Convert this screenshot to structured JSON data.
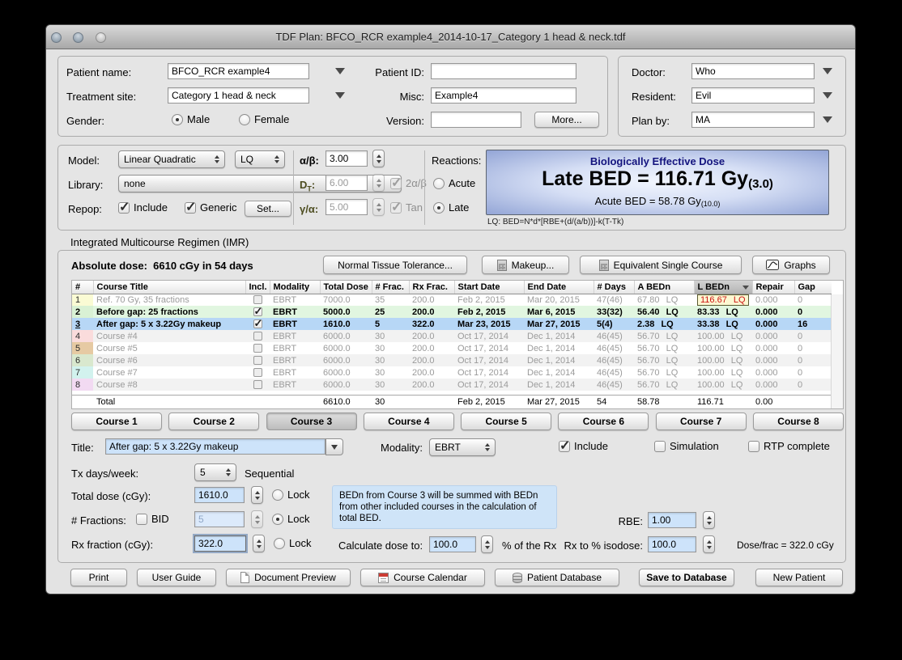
{
  "window": {
    "title": "TDF Plan: BFCO_RCR example4_2014-10-17_Category 1 head & neck.tdf"
  },
  "colors": {
    "selection_blue": "#b7d7f6",
    "field_blue": "#cde3fa",
    "alert_red": "#cc1414",
    "alert_bg": "#fdf8d2"
  },
  "patient": {
    "name_label": "Patient name:",
    "name": "BFCO_RCR example4",
    "site_label": "Treatment site:",
    "site": "Category 1 head & neck",
    "gender_label": "Gender:",
    "male": "Male",
    "female": "Female",
    "id_label": "Patient ID:",
    "id": "",
    "misc_label": "Misc:",
    "misc": "Example4",
    "version_label": "Version:",
    "version": "",
    "more": "More...",
    "doctor_label": "Doctor:",
    "doctor": "Who",
    "resident_label": "Resident:",
    "resident": "Evil",
    "planby_label": "Plan by:",
    "planby": "MA"
  },
  "model": {
    "model_label": "Model:",
    "model_value": "Linear Quadratic",
    "model_short": "LQ",
    "library_label": "Library:",
    "library_value": "none",
    "repop_label": "Repop:",
    "include": "Include",
    "generic": "Generic",
    "set": "Set...",
    "ab_label": "α/β:",
    "ab_value": "3.00",
    "dt_pre": "D",
    "dt_sub": "T",
    "dt_post": ":",
    "dt_value": "6.00",
    "dt_check": "2α/β",
    "ga_label": "γ/α:",
    "ga_value": "5.00",
    "ga_check": "Tan",
    "reactions_label": "Reactions:",
    "acute": "Acute",
    "late": "Late"
  },
  "bed": {
    "title": "Biologically Effective Dose",
    "late_text": "Late BED = 116.71 Gy",
    "late_sub": "(3.0)",
    "acute_text": "Acute BED = 58.78 Gy",
    "acute_sub": "(10.0)",
    "formula": "LQ: BED=N*d*[RBE+(d/(a/b))]-k(T-Tk)"
  },
  "imr": {
    "section_label": "Integrated Multicourse Regimen (IMR)",
    "absolute_dose_label": "Absolute dose:",
    "absolute_dose_value": "6610 cGy in 54 days",
    "buttons": {
      "ntt": "Normal Tissue Tolerance...",
      "makeup": "Makeup...",
      "esc": "Equivalent Single Course",
      "graphs": "Graphs"
    },
    "table": {
      "headers": [
        "#",
        "Course Title",
        "Incl.",
        "Modality",
        "Total Dose",
        "# Frac.",
        "Rx Frac.",
        "Start Date",
        "End Date",
        "# Days",
        "A BEDn",
        "L BEDn",
        "Repair",
        "Gap"
      ],
      "sorted_col": 11,
      "rows": [
        {
          "num": "1",
          "title": "Ref. 70 Gy, 35 fractions",
          "incl": false,
          "modality": "EBRT",
          "total_dose": "7000.0",
          "frac": "35",
          "rx_frac": "200.0",
          "start": "Feb 2, 2015",
          "end": "Mar 20, 2015",
          "days": "47(46)",
          "a_bedn": "67.80 LQ",
          "l_bedn": "116.67 LQ",
          "repair": "0.000",
          "gap": "0",
          "state": "dim",
          "bg": "#ffffff",
          "num_color": "#fafbd4",
          "l_alert": true
        },
        {
          "num": "2",
          "title": "Before gap: 25 fractions",
          "incl": true,
          "modality": "EBRT",
          "total_dose": "5000.0",
          "frac": "25",
          "rx_frac": "200.0",
          "start": "Feb 2, 2015",
          "end": "Mar 6, 2015",
          "days": "33(32)",
          "a_bedn": "56.40 LQ",
          "l_bedn": "83.33 LQ",
          "repair": "0.000",
          "gap": "0",
          "state": "bold",
          "bg": "#e1f6e0",
          "num_color": "#d9f1d4"
        },
        {
          "num": "3",
          "title": "After gap: 5 x 3.22Gy makeup",
          "incl": true,
          "modality": "EBRT",
          "total_dose": "1610.0",
          "frac": "5",
          "rx_frac": "322.0",
          "start": "Mar 23, 2015",
          "end": "Mar 27, 2015",
          "days": "5(4)",
          "a_bedn": "2.38 LQ",
          "l_bedn": "33.38 LQ",
          "repair": "0.000",
          "gap": "16",
          "state": "bold",
          "selected": true,
          "bg": "",
          "num_color": ""
        },
        {
          "num": "4",
          "title": "Course #4",
          "incl": false,
          "modality": "EBRT",
          "total_dose": "6000.0",
          "frac": "30",
          "rx_frac": "200.0",
          "start": "Oct 17, 2014",
          "end": "Dec 1, 2014",
          "days": "46(45)",
          "a_bedn": "56.70 LQ",
          "l_bedn": "100.00 LQ",
          "repair": "0.000",
          "gap": "0",
          "state": "dim",
          "bg": "#f2f2f2",
          "num_color": "#fadcdc"
        },
        {
          "num": "5",
          "title": "Course #5",
          "incl": false,
          "modality": "EBRT",
          "total_dose": "6000.0",
          "frac": "30",
          "rx_frac": "200.0",
          "start": "Oct 17, 2014",
          "end": "Dec 1, 2014",
          "days": "46(45)",
          "a_bedn": "56.70 LQ",
          "l_bedn": "100.00 LQ",
          "repair": "0.000",
          "gap": "0",
          "state": "dim",
          "bg": "#ffffff",
          "num_color": "#e6caa3"
        },
        {
          "num": "6",
          "title": "Course #6",
          "incl": false,
          "modality": "EBRT",
          "total_dose": "6000.0",
          "frac": "30",
          "rx_frac": "200.0",
          "start": "Oct 17, 2014",
          "end": "Dec 1, 2014",
          "days": "46(45)",
          "a_bedn": "56.70 LQ",
          "l_bedn": "100.00 LQ",
          "repair": "0.000",
          "gap": "0",
          "state": "dim",
          "bg": "#f2f2f2",
          "num_color": "#d9e8ce"
        },
        {
          "num": "7",
          "title": "Course #7",
          "incl": false,
          "modality": "EBRT",
          "total_dose": "6000.0",
          "frac": "30",
          "rx_frac": "200.0",
          "start": "Oct 17, 2014",
          "end": "Dec 1, 2014",
          "days": "46(45)",
          "a_bedn": "56.70 LQ",
          "l_bedn": "100.00 LQ",
          "repair": "0.000",
          "gap": "0",
          "state": "dim",
          "bg": "#ffffff",
          "num_color": "#d2f2ee"
        },
        {
          "num": "8",
          "title": "Course #8",
          "incl": false,
          "modality": "EBRT",
          "total_dose": "6000.0",
          "frac": "30",
          "rx_frac": "200.0",
          "start": "Oct 17, 2014",
          "end": "Dec 1, 2014",
          "days": "46(45)",
          "a_bedn": "56.70 LQ",
          "l_bedn": "100.00 LQ",
          "repair": "0.000",
          "gap": "0",
          "state": "dim",
          "bg": "#f2f2f2",
          "num_color": "#f2daf2"
        }
      ],
      "total": {
        "title": "Total",
        "total_dose": "6610.0",
        "frac": "30",
        "start": "Feb 2, 2015",
        "end": "Mar 27, 2015",
        "days": "54",
        "a_bedn": "58.78",
        "l_bedn": "116.71",
        "repair": "0.00"
      }
    },
    "course_tabs": [
      "Course 1",
      "Course 2",
      "Course 3",
      "Course 4",
      "Course 5",
      "Course 6",
      "Course 7",
      "Course 8"
    ],
    "active_course": 2
  },
  "course": {
    "title_label": "Title:",
    "title_value": "After gap: 5 x 3.22Gy makeup",
    "modality_label": "Modality:",
    "modality_value": "EBRT",
    "include": "Include",
    "simulation": "Simulation",
    "rtp": "RTP complete",
    "txdays_label": "Tx days/week:",
    "txdays_value": "5",
    "sequential": "Sequential",
    "totaldose_label": "Total dose (cGy):",
    "totaldose_value": "1610.0",
    "lock_label": "Lock",
    "fractions_label": "# Fractions:",
    "bid": "BID",
    "fractions_value": "5",
    "rxfraction_label": "Rx fraction (cGy):",
    "rxfraction_value": "322.0",
    "info_text": "BEDn from Course 3 will be summed with BEDn from other included courses in the calculation of total BED.",
    "calc_label": "Calculate dose to:",
    "calc_value": "100.0",
    "calc_suffix": "% of the Rx",
    "rbe_label": "RBE:",
    "rbe_value": "1.00",
    "isodose_label": "Rx to % isodose:",
    "isodose_value": "100.0",
    "dosefrac": "Dose/frac = 322.0 cGy"
  },
  "footer": {
    "print": "Print",
    "user_guide": "User Guide",
    "doc_preview": "Document Preview",
    "course_calendar": "Course Calendar",
    "patient_db": "Patient Database",
    "save_db": "Save to Database",
    "new_patient": "New Patient"
  }
}
